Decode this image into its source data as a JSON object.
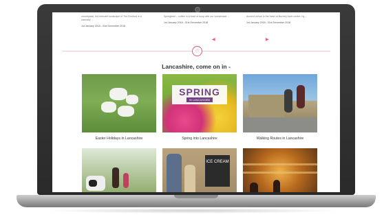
{
  "page": {
    "snippets": [
      {
        "text": "countryside, the intricate soulscape of The Dunford in a naturally ...",
        "date": "1st January 2018 - 31st December 2018"
      },
      {
        "text": "Springtime – coffee in a bowl of soup with our homemade ...",
        "date": "1st January 2018 - 31st December 2018"
      },
      {
        "text": "Ancient venue in the heart of Burnley town centre, by ...",
        "date": "1st January 2018 - 31st December 2018"
      }
    ],
    "carousel": {
      "prev": "◀",
      "next": "▶"
    },
    "divider_icon": "heart-icon",
    "heading": "Lancashire, come on in -",
    "tiles": [
      {
        "caption": "Easter Holidays in Lancashire"
      },
      {
        "caption": "Spring into Lancashire",
        "overlay_big": "SPRING",
        "overlay_small": "IN LANCASHIRE"
      },
      {
        "caption": "Walking Routes in Lancashire"
      },
      {
        "caption": ""
      },
      {
        "caption": "",
        "sign_text": "ICE CREAM"
      },
      {
        "caption": ""
      }
    ]
  },
  "colors": {
    "accent": "#e05a7a",
    "divider": "#f0c8d2",
    "heading": "#333333"
  }
}
